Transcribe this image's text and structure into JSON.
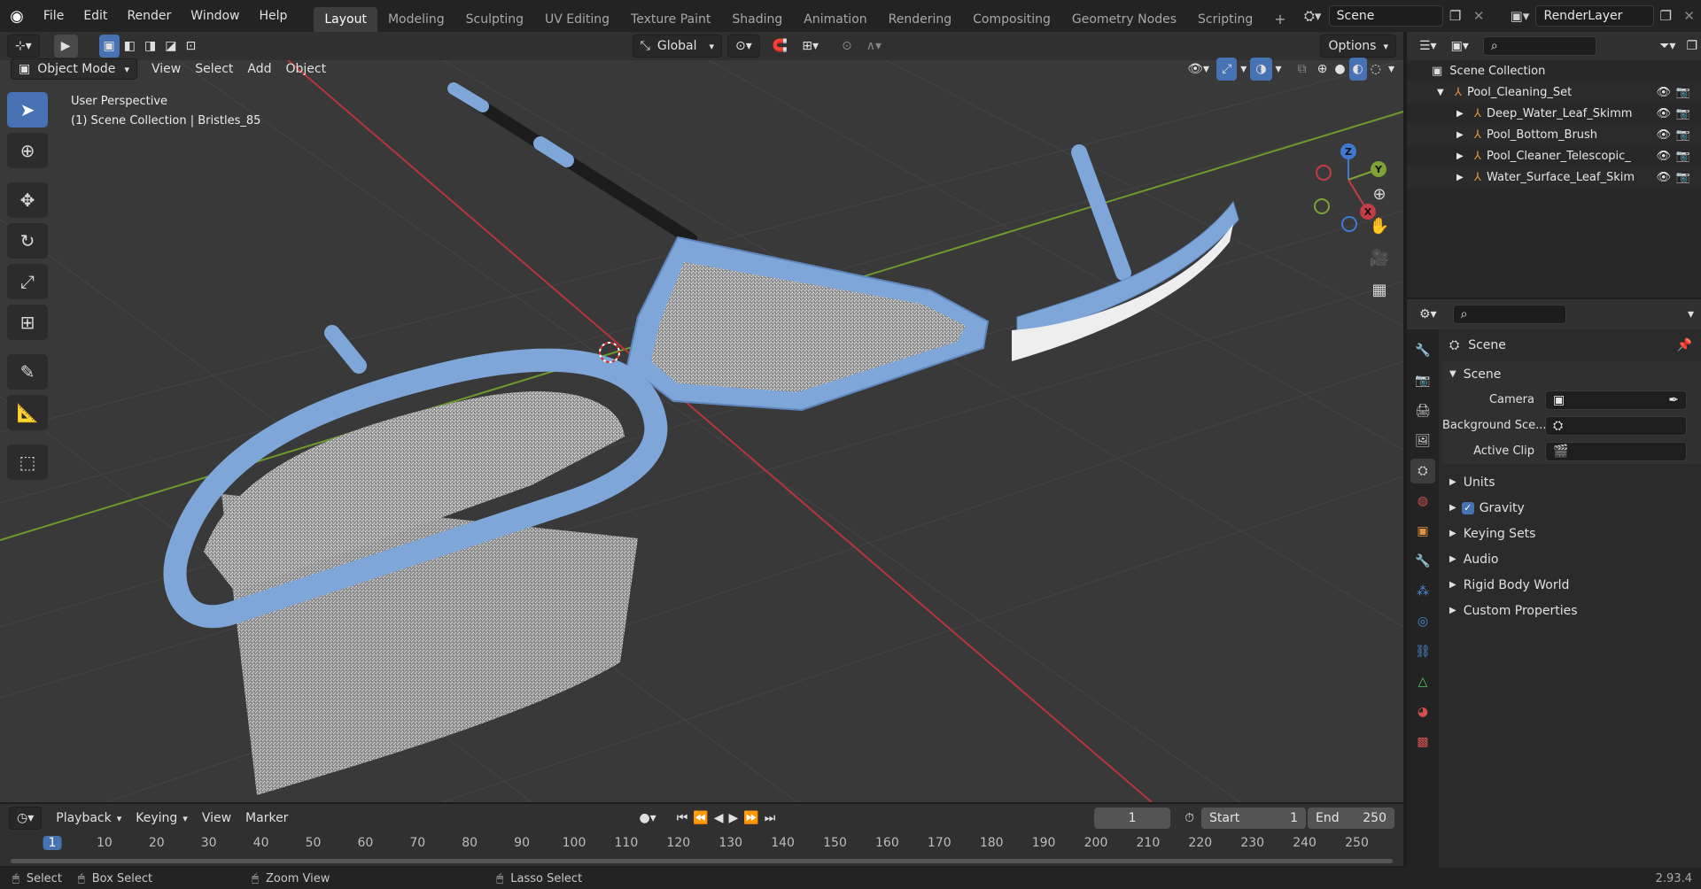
{
  "topbar": {
    "menus": [
      "File",
      "Edit",
      "Render",
      "Window",
      "Help"
    ],
    "workspaces": [
      "Layout",
      "Modeling",
      "Sculpting",
      "UV Editing",
      "Texture Paint",
      "Shading",
      "Animation",
      "Rendering",
      "Compositing",
      "Geometry Nodes",
      "Scripting"
    ],
    "active_workspace": "Layout",
    "scene": "Scene",
    "view_layer": "RenderLayer"
  },
  "viewport": {
    "header": {
      "transform_orientation": "Global",
      "options": "Options"
    },
    "mode": "Object Mode",
    "menus": [
      "View",
      "Select",
      "Add",
      "Object"
    ],
    "overlay_title": "User Perspective",
    "overlay_subtitle": "(1) Scene Collection | Bristles_85",
    "gizmo": {
      "x": "X",
      "y": "Y",
      "z": "Z"
    }
  },
  "outliner": {
    "root": "Scene Collection",
    "collection": "Pool_Cleaning_Set",
    "objects": [
      "Deep_Water_Leaf_Skimm",
      "Pool_Bottom_Brush",
      "Pool_Cleaner_Telescopic_",
      "Water_Surface_Leaf_Skim"
    ]
  },
  "properties": {
    "context": "Scene",
    "panel": "Scene",
    "fields": [
      {
        "label": "Camera",
        "value": ""
      },
      {
        "label": "Background Sce...",
        "value": ""
      },
      {
        "label": "Active Clip",
        "value": ""
      }
    ],
    "sections": [
      "Units",
      "Gravity",
      "Keying Sets",
      "Audio",
      "Rigid Body World",
      "Custom Properties"
    ]
  },
  "timeline": {
    "menus": [
      "Playback",
      "Keying",
      "View",
      "Marker"
    ],
    "current_frame": "1",
    "start_label": "Start",
    "start": "1",
    "end_label": "End",
    "end": "250",
    "ticks": [
      "1",
      "10",
      "20",
      "30",
      "40",
      "50",
      "60",
      "70",
      "80",
      "90",
      "100",
      "110",
      "120",
      "130",
      "140",
      "150",
      "160",
      "170",
      "180",
      "190",
      "200",
      "210",
      "220",
      "230",
      "240",
      "250"
    ]
  },
  "statusbar": {
    "select": "Select",
    "box_select": "Box Select",
    "zoom_view": "Zoom View",
    "lasso_select": "Lasso Select",
    "version": "2.93.4"
  },
  "colors": {
    "accent": "#4772b3",
    "axis_x": "#c43c45",
    "axis_y": "#7fa332",
    "axis_z": "#3f7ad2",
    "mesh": "#7fa6d8"
  }
}
